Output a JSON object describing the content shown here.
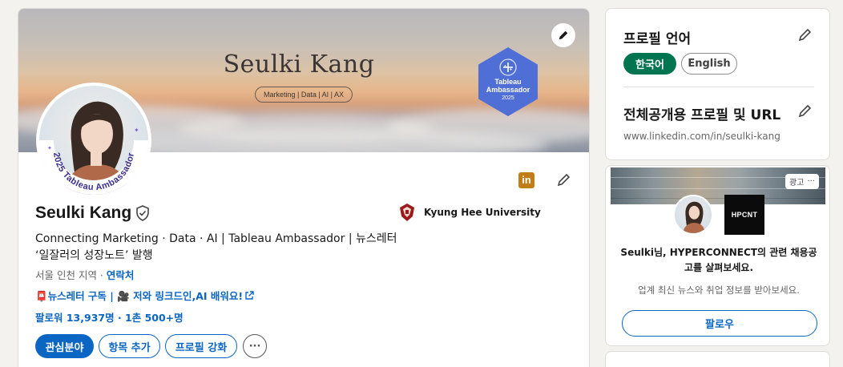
{
  "profile": {
    "banner": {
      "title": "Seulki Kang",
      "tagline": "Marketing | Data | AI | AX",
      "badge": {
        "line1": "Tableau",
        "line2": "Ambassador",
        "year": "2025"
      }
    },
    "avatar_frame_text": "2025 Tableau Ambassador",
    "name": "Seulki Kang",
    "headline_line1": "Connecting Marketing · Data · AI | Tableau Ambassador | 뉴스레터",
    "headline_line2": "‘일잘러의 성장노트’ 발행",
    "location": "서울 인천 지역",
    "location_sep": " · ",
    "contact_label": "연락처",
    "promo_link": "📮뉴스레터 구독 | 🎥 저와 링크드인,AI 배워요!",
    "followers": "팔로워 13,937명 · 1촌 500+명",
    "education": {
      "name": "Kyung Hee University"
    },
    "buttons": {
      "open_to": "관심분야",
      "add_section": "항목 추가",
      "enhance": "프로필 강화",
      "more": "···"
    }
  },
  "sidebar": {
    "language": {
      "title": "프로필 언어",
      "options": [
        {
          "label": "한국어",
          "active": true
        },
        {
          "label": "English",
          "active": false
        }
      ]
    },
    "public_profile": {
      "title": "전체공개용 프로필 및 URL",
      "url": "www.linkedin.com/in/seulki-kang"
    },
    "ad": {
      "label": "광고",
      "more": "···",
      "company_logo_text": "HPCNT",
      "text": "Seulki님, HYPERCONNECT의 관련 채용공고를 살펴보세요.",
      "subtext": "업계 최신 뉴스와 취업 정보를 받아보세요.",
      "follow_label": "팔로우"
    }
  },
  "colors": {
    "linkedin_blue": "#0a66c2",
    "active_green": "#01754f",
    "background": "#f4f2ee",
    "linkedin_icon": "#c37d16"
  }
}
